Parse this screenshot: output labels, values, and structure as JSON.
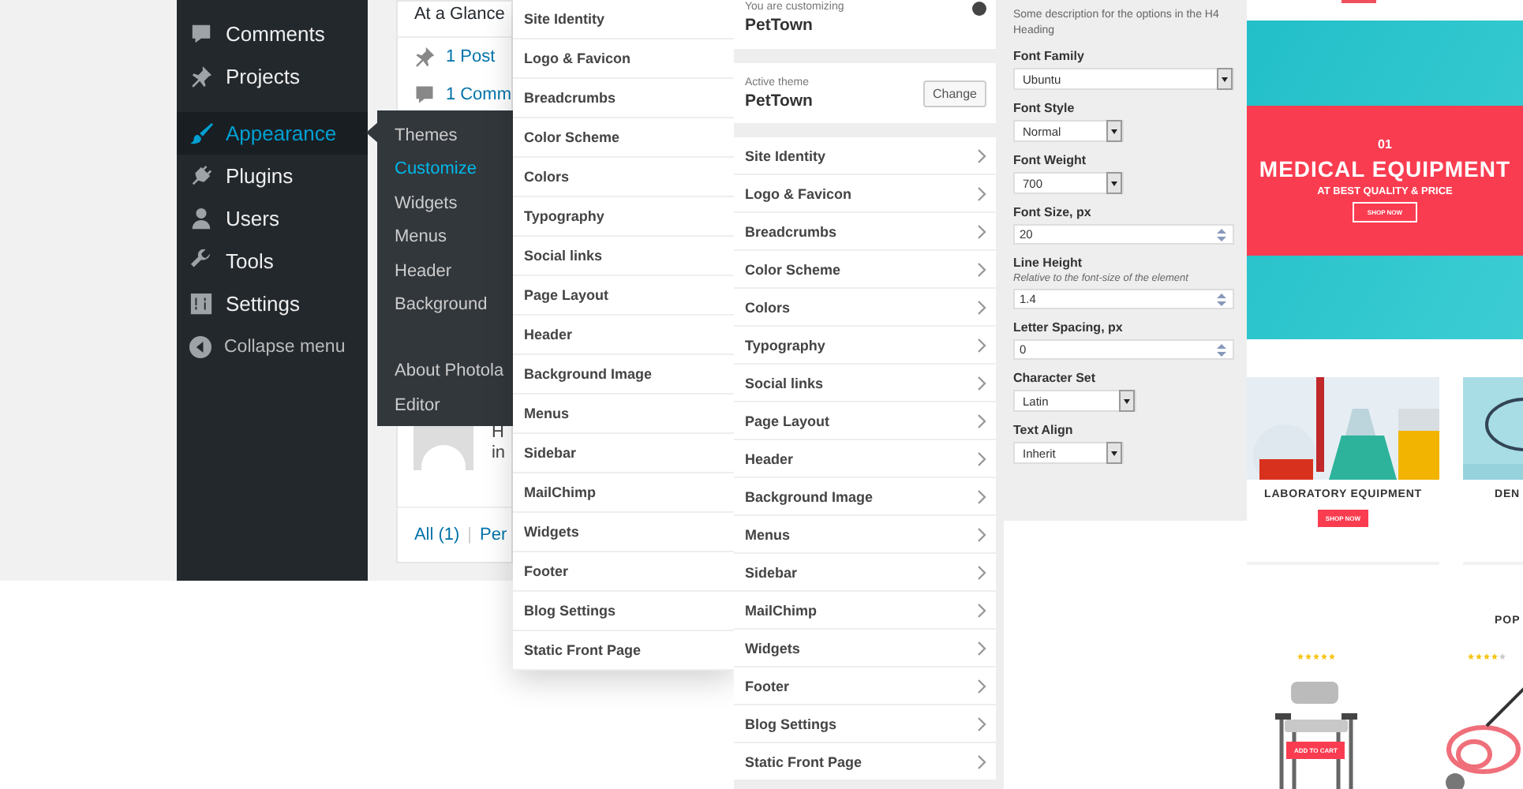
{
  "admin": {
    "menu": [
      {
        "label": "Comments",
        "selected": false
      },
      {
        "label": "Projects",
        "selected": false
      },
      {
        "label": "Appearance",
        "selected": true
      },
      {
        "label": "Plugins",
        "selected": false
      },
      {
        "label": "Users",
        "selected": false
      },
      {
        "label": "Tools",
        "selected": false
      },
      {
        "label": "Settings",
        "selected": false
      }
    ],
    "collapse_label": "Collapse menu",
    "submenu_top": [
      {
        "label": "Themes",
        "selected": false
      },
      {
        "label": "Customize",
        "selected": true
      },
      {
        "label": "Widgets",
        "selected": false
      },
      {
        "label": "Menus",
        "selected": false
      },
      {
        "label": "Header",
        "selected": false
      },
      {
        "label": "Background",
        "selected": false
      }
    ],
    "submenu_bottom": [
      {
        "label": "About Photola",
        "selected": false
      },
      {
        "label": "Editor",
        "selected": false
      }
    ],
    "dashboard": {
      "widget_title": "At a Glance",
      "stats": [
        "1 Post",
        "1 Comm"
      ],
      "comment_lines": [
        "H",
        "in"
      ],
      "filters": [
        "All (1)",
        "|",
        "Per"
      ]
    }
  },
  "sections_panel": {
    "items": [
      "Site Identity",
      "Logo & Favicon",
      "Breadcrumbs",
      "Color Scheme",
      "Colors",
      "Typography",
      "Social links",
      "Page Layout",
      "Header",
      "Background Image",
      "Menus",
      "Sidebar",
      "MailChimp",
      "Widgets",
      "Footer",
      "Blog Settings",
      "Static Front Page"
    ]
  },
  "customizer": {
    "heading_label": "You are customizing",
    "site_name": "PetTown",
    "active_theme_label": "Active theme",
    "theme_name": "PetTown",
    "change_button": "Change",
    "sections": [
      "Site Identity",
      "Logo & Favicon",
      "Breadcrumbs",
      "Color Scheme",
      "Colors",
      "Typography",
      "Social links",
      "Page Layout",
      "Header",
      "Background Image",
      "Menus",
      "Sidebar",
      "MailChimp",
      "Widgets",
      "Footer",
      "Blog Settings",
      "Static Front Page"
    ]
  },
  "typography": {
    "description": "Some description for the options in the H4 Heading",
    "fields": [
      {
        "kind": "select",
        "label": "Font Family",
        "value": "Ubuntu"
      },
      {
        "kind": "select",
        "label": "Font Style",
        "value": "Normal"
      },
      {
        "kind": "select",
        "label": "Font Weight",
        "value": "700"
      },
      {
        "kind": "number",
        "label": "Font Size, px",
        "value": "20"
      },
      {
        "kind": "number",
        "label": "Line Height",
        "hint": "Relative to the font-size of the element",
        "value": "1.4"
      },
      {
        "kind": "number",
        "label": "Letter Spacing, px",
        "value": "0"
      },
      {
        "kind": "select",
        "label": "Character Set",
        "value": "Latin"
      },
      {
        "kind": "select",
        "label": "Text Align",
        "value": "Inherit"
      }
    ]
  },
  "preview": {
    "hero": {
      "number": "01",
      "title": "MEDICAL EQUIPMENT",
      "subtitle": "AT BEST QUALITY & PRICE",
      "button": "SHOP NOW"
    },
    "categories": [
      {
        "title": "LABORATORY EQUIPMENT",
        "button": "SHOP NOW"
      },
      {
        "title": "DEN"
      }
    ],
    "popular_heading": "POP",
    "products": [
      {
        "stars": 5,
        "button": "ADD TO CART"
      },
      {
        "stars": 4
      }
    ]
  }
}
